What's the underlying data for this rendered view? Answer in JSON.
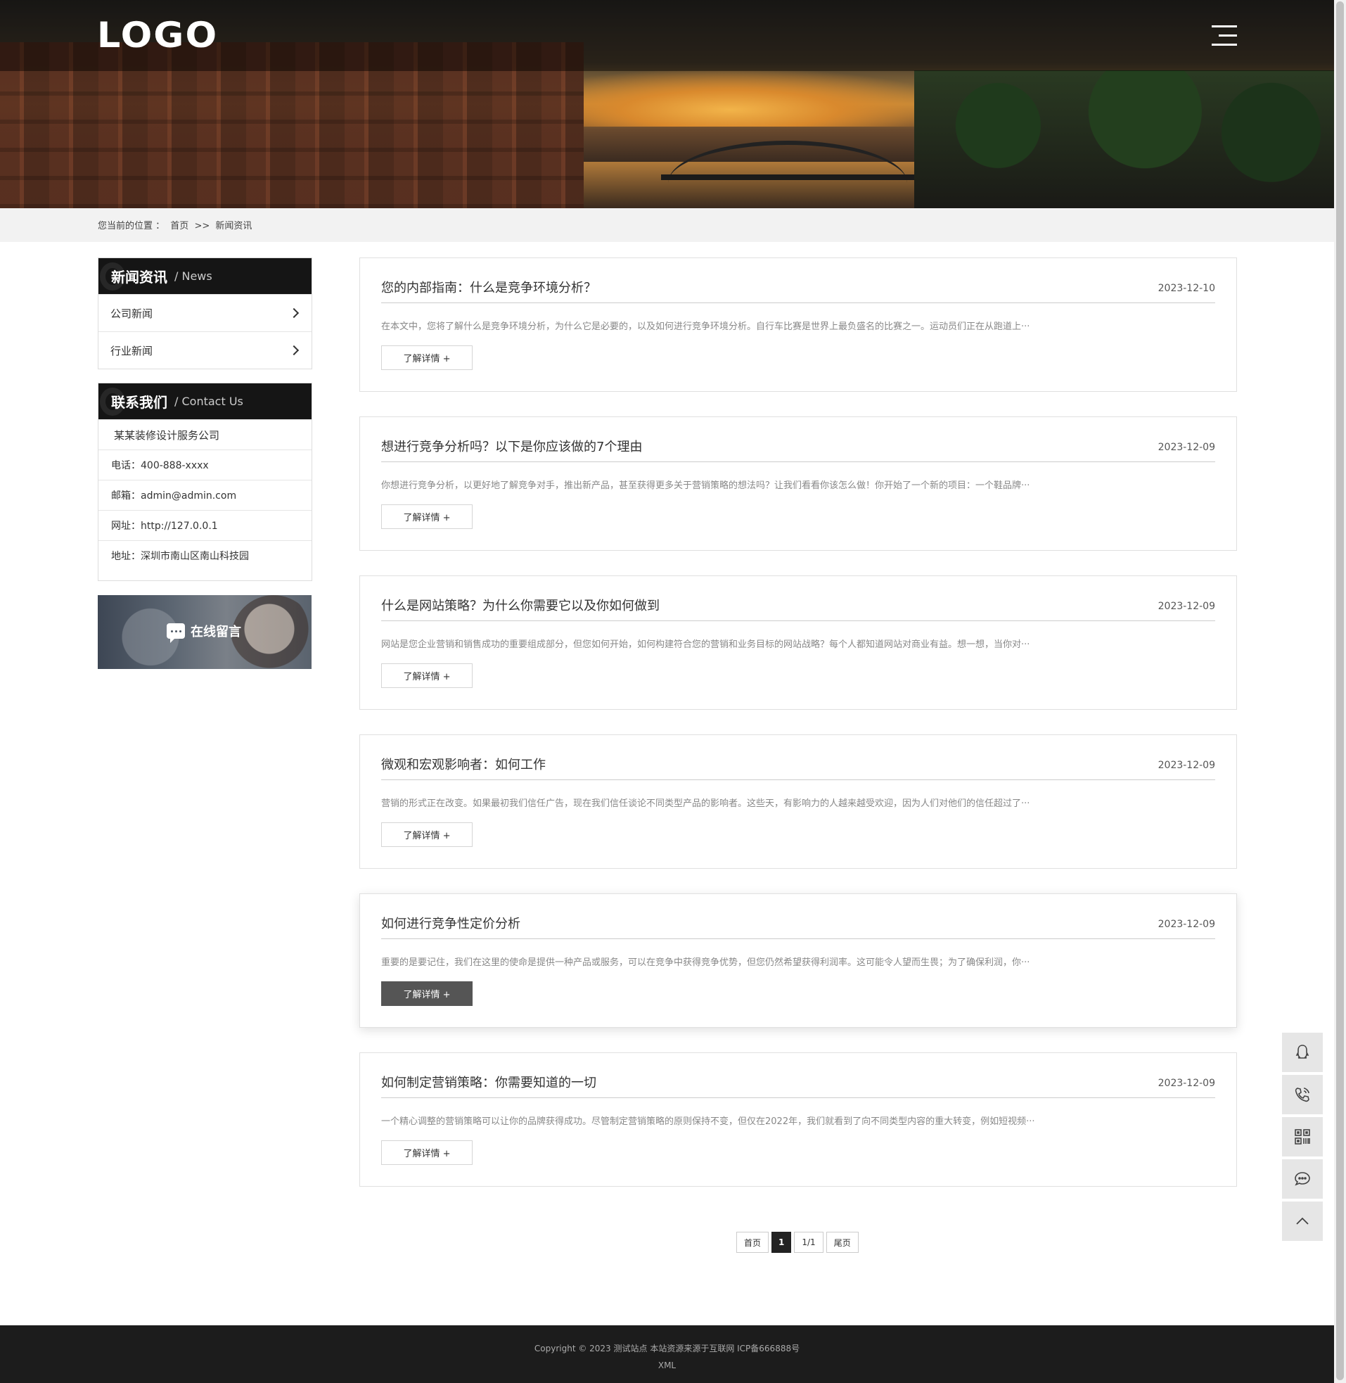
{
  "header": {
    "logo_text": "LOGO",
    "menu_icon": "hamburger-menu-icon"
  },
  "breadcrumb": {
    "prefix": "您当前的位置 ：",
    "home": "首页",
    "separator": ">>",
    "current": "新闻资讯"
  },
  "sidebar": {
    "news_box": {
      "title_cn": "新闻资讯",
      "title_en": "/ News",
      "items": [
        {
          "label": "公司新闻"
        },
        {
          "label": "行业新闻"
        }
      ]
    },
    "contact_box": {
      "title_cn": "联系我们",
      "title_en": "/ Contact Us",
      "company": "某某装修设计服务公司",
      "phone": "电话：400-888-xxxx",
      "email": "邮箱：admin@admin.com",
      "website": "网址：http://127.0.0.1",
      "address": "地址：深圳市南山区南山科技园"
    },
    "message_banner": {
      "label": "在线留言",
      "icon": "chat-bubble-icon"
    }
  },
  "articles": [
    {
      "title": "您的内部指南：什么是竞争环境分析？",
      "date": "2023-12-10",
      "excerpt": "在本文中，您将了解什么是竞争环境分析，为什么它是必要的，以及如何进行竞争环境分析。自行车比赛是世界上最负盛名的比赛之一。运动员们正在从跑道上···",
      "more": "了解详情 +"
    },
    {
      "title": "想进行竞争分析吗？以下是你应该做的7个理由",
      "date": "2023-12-09",
      "excerpt": "你想进行竞争分析，以更好地了解竞争对手，推出新产品，甚至获得更多关于营销策略的想法吗？让我们看看你该怎么做！你开始了一个新的项目：一个鞋品牌···",
      "more": "了解详情 +"
    },
    {
      "title": "什么是网站策略？为什么你需要它以及你如何做到",
      "date": "2023-12-09",
      "excerpt": "网站是您企业营销和销售成功的重要组成部分，但您如何开始，如何构建符合您的营销和业务目标的网站战略？每个人都知道网站对商业有益。想一想，当你对···",
      "more": "了解详情 +"
    },
    {
      "title": "微观和宏观影响者：如何工作",
      "date": "2023-12-09",
      "excerpt": "营销的形式正在改变。如果最初我们信任广告，现在我们信任谈论不同类型产品的影响者。这些天，有影响力的人越来越受欢迎，因为人们对他们的信任超过了···",
      "more": "了解详情 +"
    },
    {
      "title": "如何进行竞争性定价分析",
      "date": "2023-12-09",
      "excerpt": "重要的是要记住，我们在这里的使命是提供一种产品或服务，可以在竞争中获得竞争优势，但您仍然希望获得利润率。这可能令人望而生畏；为了确保利润，你···",
      "more": "了解详情 +"
    },
    {
      "title": "如何制定营销策略：你需要知道的一切",
      "date": "2023-12-09",
      "excerpt": "一个精心调整的营销策略可以让你的品牌获得成功。尽管制定营销策略的原则保持不变，但仅在2022年，我们就看到了向不同类型内容的重大转变，例如短视频···",
      "more": "了解详情 +"
    }
  ],
  "pagination": {
    "first": "首页",
    "current": "1",
    "total": "1/1",
    "last": "尾页"
  },
  "footer": {
    "copyright": "Copyright © 2023 测试站点 本站资源来源于互联网 ICP备666888号",
    "xml": "XML"
  },
  "float_toolbar": {
    "items": [
      "qq-icon",
      "phone-icon",
      "qrcode-icon",
      "message-icon",
      "back-to-top-icon"
    ]
  }
}
